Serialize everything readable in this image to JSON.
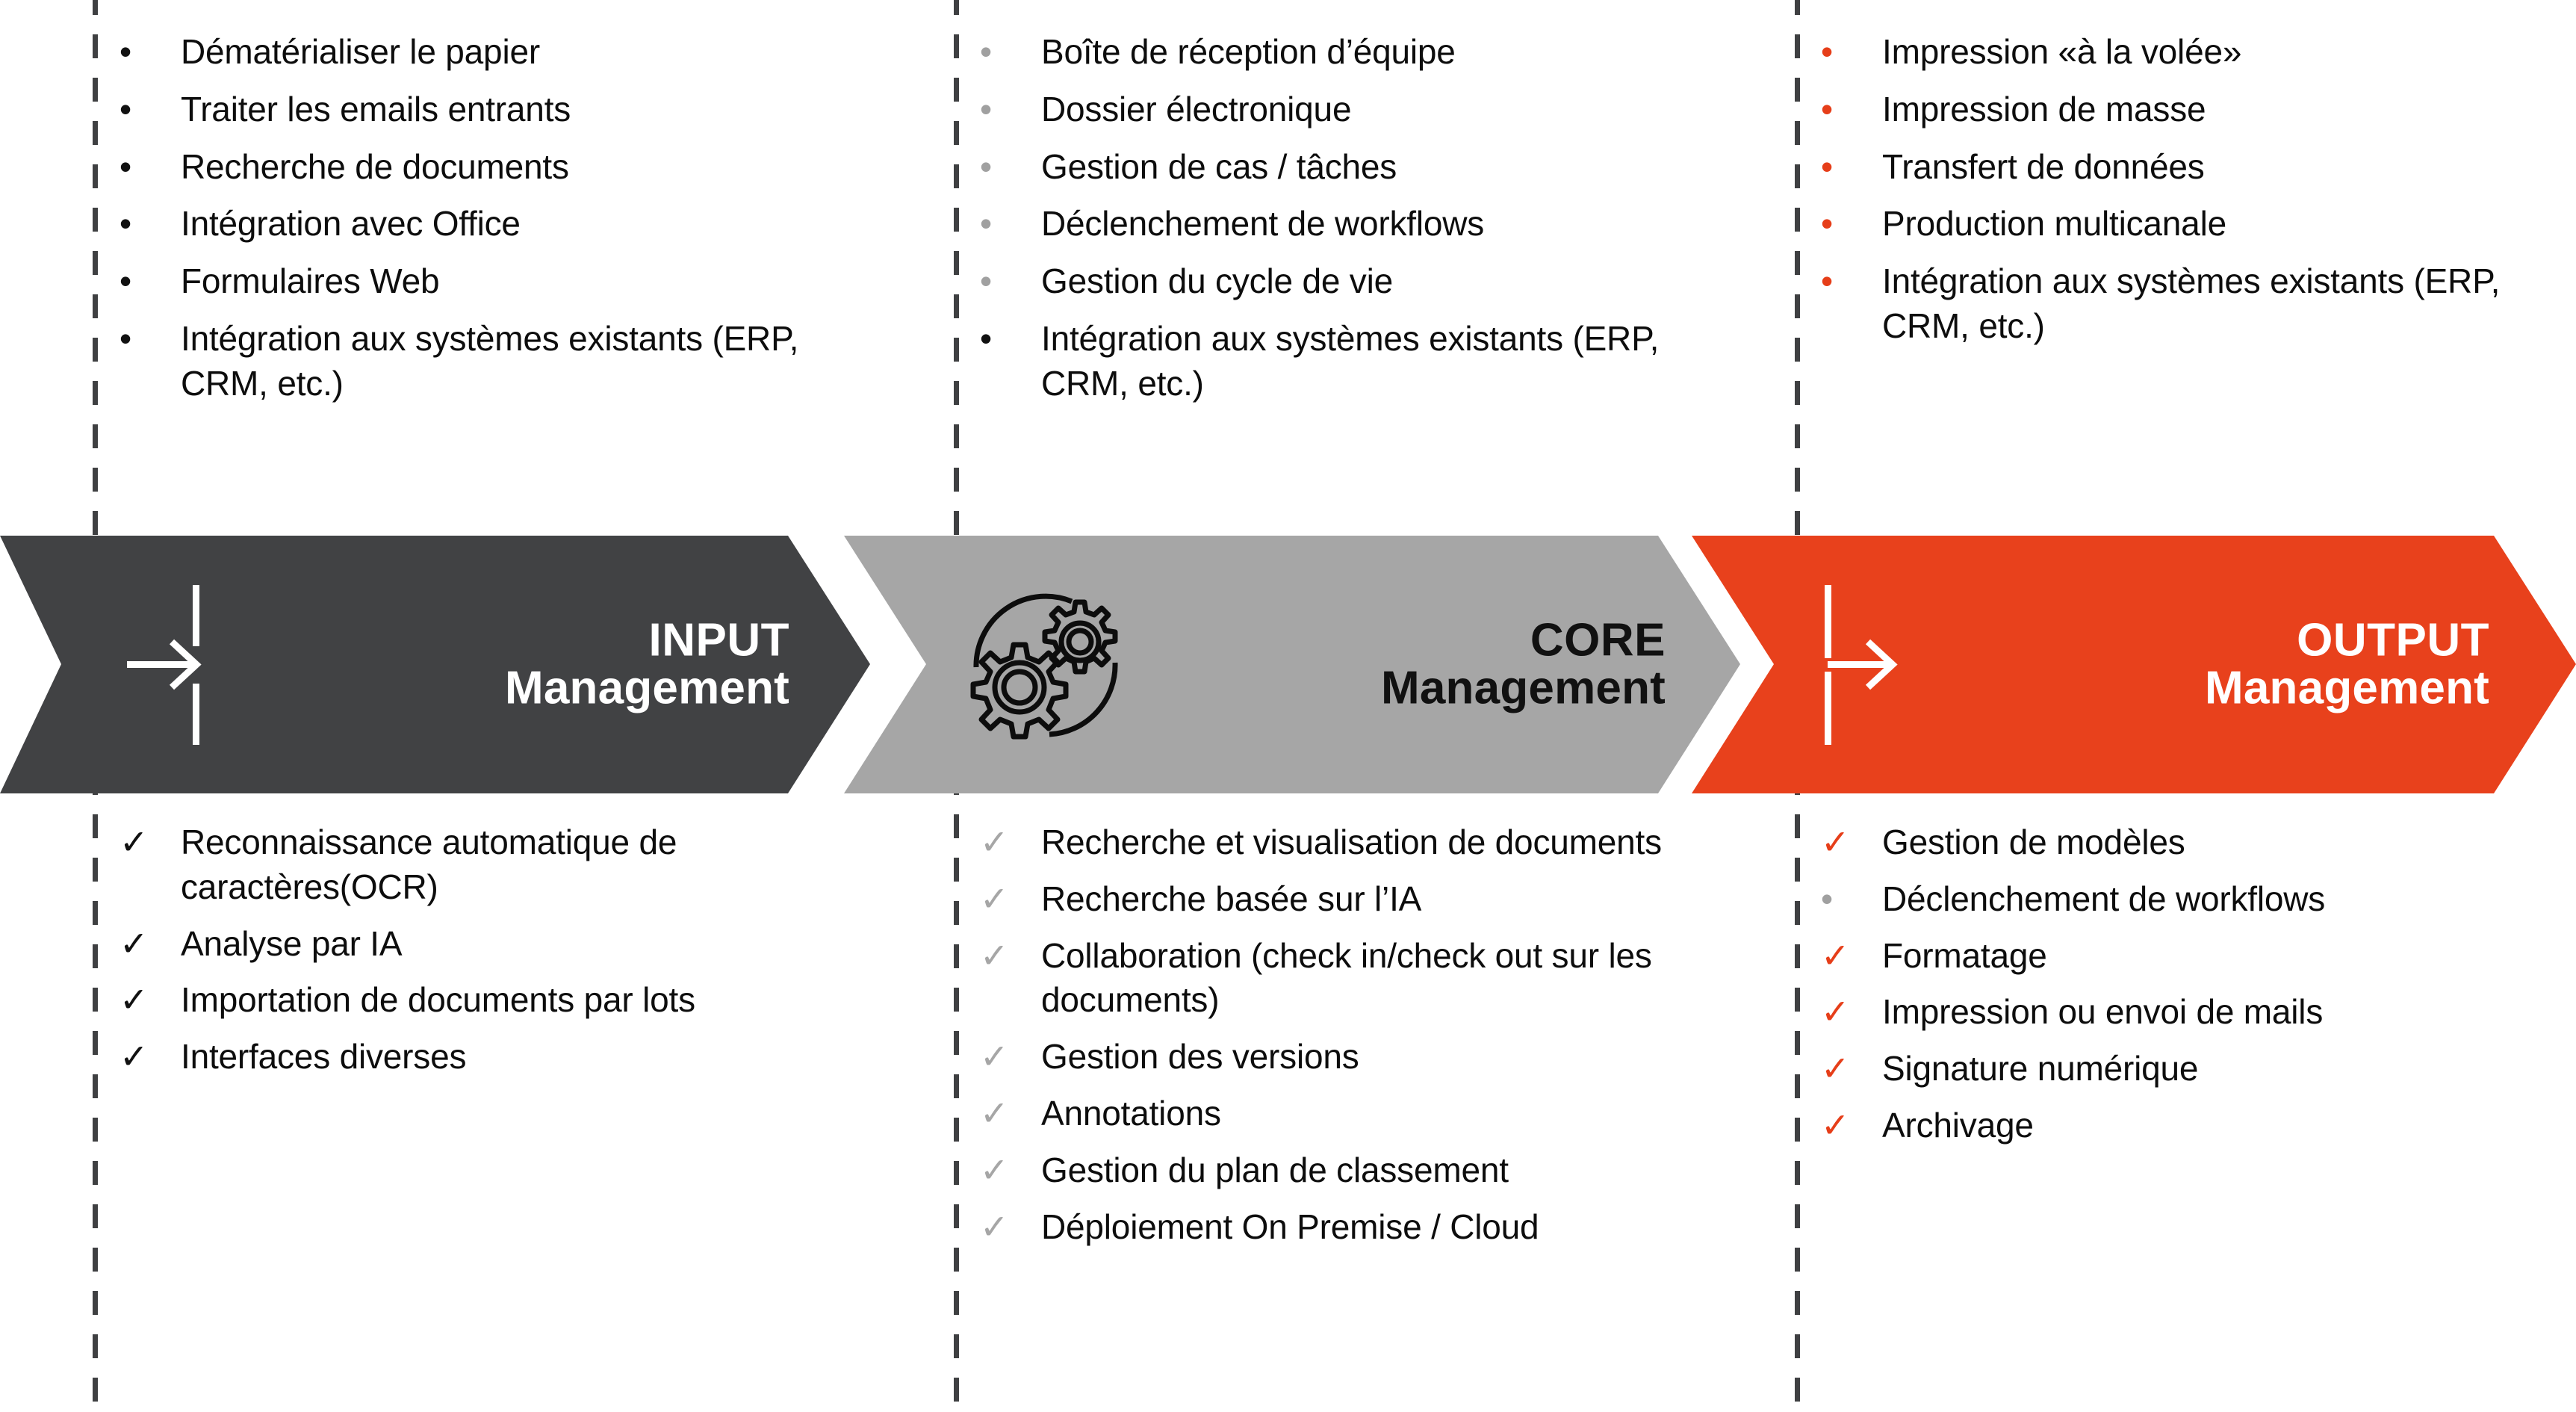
{
  "stages": [
    {
      "id": "input",
      "line1": "INPUT",
      "line2": "Management",
      "bg_color": "#414244",
      "text_color": "#FFFFFF",
      "icon": "arrow-in-icon",
      "inputs_title": "",
      "inputs": [
        {
          "marker": "dot-black",
          "text": "Dématérialiser le papier"
        },
        {
          "marker": "dot-black",
          "text": "Traiter les emails entrants"
        },
        {
          "marker": "dot-black",
          "text": "Recherche de documents"
        },
        {
          "marker": "dot-black",
          "text": "Intégration avec Office"
        },
        {
          "marker": "dot-black",
          "text": "Formulaires Web"
        },
        {
          "marker": "dot-black",
          "text": "Intégration aux systèmes existants (ERP, CRM, etc.)"
        }
      ],
      "capabilities": [
        {
          "marker": "chk-black",
          "text": "Reconnaissance automatique de caractères(OCR)"
        },
        {
          "marker": "chk-black",
          "text": "Analyse par IA"
        },
        {
          "marker": "chk-black",
          "text": "Importation de documents par lots"
        },
        {
          "marker": "chk-black",
          "text": "Interfaces diverses"
        }
      ]
    },
    {
      "id": "core",
      "line1": "CORE",
      "line2": "Management",
      "bg_color": "#A6A6A6",
      "text_color": "#111111",
      "icon": "gears-icon",
      "inputs": [
        {
          "marker": "dot-gray",
          "text": "Boîte de réception d’équipe"
        },
        {
          "marker": "dot-gray",
          "text": "Dossier électronique"
        },
        {
          "marker": "dot-gray",
          "text": "Gestion de cas / tâches"
        },
        {
          "marker": "dot-gray",
          "text": "Déclenchement de workflows"
        },
        {
          "marker": "dot-gray",
          "text": "Gestion du cycle de vie"
        },
        {
          "marker": "dot-black",
          "text": "Intégration aux systèmes existants (ERP, CRM, etc.)"
        }
      ],
      "capabilities": [
        {
          "marker": "chk-gray",
          "text": "Recherche et visualisation de documents"
        },
        {
          "marker": "chk-gray",
          "text": "Recherche basée sur l’IA"
        },
        {
          "marker": "chk-gray",
          "text": "Collaboration (check in/check out sur les documents)"
        },
        {
          "marker": "chk-gray",
          "text": "Gestion des versions"
        },
        {
          "marker": "chk-gray",
          "text": "Annotations"
        },
        {
          "marker": "chk-gray",
          "text": "Gestion du plan de classement"
        },
        {
          "marker": "chk-gray",
          "text": "Déploiement On Premise / Cloud"
        }
      ]
    },
    {
      "id": "output",
      "line1": "OUTPUT",
      "line2": "Management",
      "bg_color": "#E8411C",
      "text_color": "#FFFFFF",
      "icon": "arrow-out-icon",
      "inputs": [
        {
          "marker": "dot-red",
          "text": "Impression «à la volée»"
        },
        {
          "marker": "dot-red",
          "text": "Impression de masse"
        },
        {
          "marker": "dot-red",
          "text": "Transfert de données"
        },
        {
          "marker": "dot-red",
          "text": "Production multicanale"
        },
        {
          "marker": "dot-red",
          "text": "Intégration aux systèmes existants (ERP, CRM, etc.)"
        }
      ],
      "capabilities": [
        {
          "marker": "chk-red",
          "text": "Gestion de modèles"
        },
        {
          "marker": "dot-gray",
          "text": "Déclenchement de workflows"
        },
        {
          "marker": "chk-red",
          "text": "Formatage"
        },
        {
          "marker": "chk-red",
          "text": "Impression ou envoi de mails"
        },
        {
          "marker": "chk-red",
          "text": "Signature numérique"
        },
        {
          "marker": "chk-red",
          "text": "Archivage"
        }
      ]
    }
  ],
  "markers": {
    "dot-black": "•",
    "dot-gray": "•",
    "dot-red": "•",
    "chk-black": "✓",
    "chk-gray": "✓",
    "chk-red": "✓"
  },
  "colors": {
    "accent_red": "#E8411C",
    "dark_gray": "#414244",
    "mid_gray": "#A6A6A6",
    "divider": "#3F4042",
    "text": "#0D0D0D"
  }
}
